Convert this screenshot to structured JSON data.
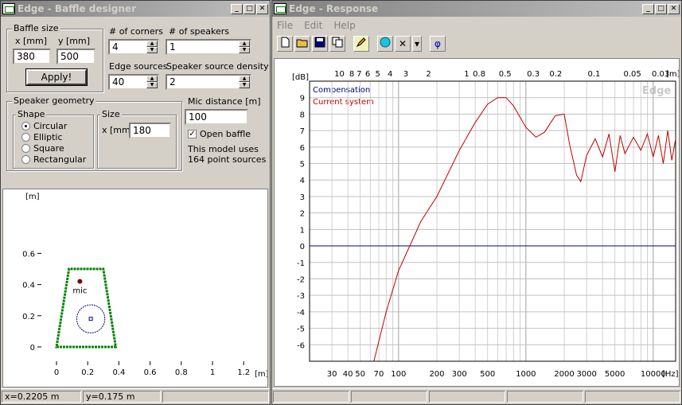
{
  "designer": {
    "title": "Edge - Baffle designer",
    "baffle_size_label": "Baffle size",
    "x_label": "x [mm]",
    "y_label": "y [mm]",
    "x_value": "380",
    "y_value": "500",
    "apply_label": "Apply!",
    "corners_label": "# of corners",
    "corners_value": "4",
    "speakers_label": "# of speakers",
    "speakers_value": "1",
    "edge_sources_label": "Edge sources",
    "edge_sources_value": "40",
    "density_label": "Speaker source density",
    "density_value": "2",
    "geometry_label": "Speaker geometry",
    "shape_label": "Shape",
    "shapes": [
      "Circular",
      "Elliptic",
      "Square",
      "Rectangular"
    ],
    "selected_shape": "Circular",
    "size_label": "Size",
    "size_x_label": "x [mm]",
    "size_x_value": "180",
    "mic_distance_label": "Mic distance [m]",
    "mic_distance_value": "100",
    "open_baffle_label": "Open baffle",
    "open_baffle_checked": true,
    "model_info_1": "This model uses",
    "model_info_2": "164 point sources",
    "plot": {
      "y_unit": "[m]",
      "x_unit": "[m]",
      "y_ticks": [
        "0.6",
        "0.4",
        "0.2",
        "0"
      ],
      "x_ticks": [
        "0",
        "0.2",
        "0.4",
        "0.6",
        "0.8",
        "1",
        "1.2"
      ],
      "mic_label": "mic",
      "baffle_corners_m": [
        [
          0,
          0
        ],
        [
          0.38,
          0
        ],
        [
          0.3,
          0.5
        ],
        [
          0.08,
          0.5
        ]
      ],
      "speaker_center_m": [
        0.22,
        0.18
      ],
      "speaker_diameter_m": 0.18,
      "mic_m": [
        0.15,
        0.42
      ]
    },
    "status_x": "x=0.2205 m",
    "status_y": "y=0.175 m"
  },
  "response": {
    "title": "Edge - Response",
    "menu": [
      "File",
      "Edit",
      "Help"
    ],
    "toolbar_icons": [
      "new-icon",
      "open-icon",
      "save-icon",
      "copy-icon",
      "pencil-icon",
      "sphere-icon",
      "delete-icon",
      "dropdown-icon",
      "phase-icon"
    ],
    "phase_symbol": "φ",
    "delete_symbol": "✕",
    "dropdown_symbol": "▾",
    "watermark": "Edge",
    "colors": {
      "compensation": "#000080",
      "current": "#c00000"
    },
    "chart_data": {
      "type": "line",
      "xlabel": "[Hz]",
      "ylabel": "[dB]",
      "top_axis_unit": "[m]",
      "x_scale": "log",
      "xlim": [
        20,
        15000
      ],
      "ylim": [
        -7,
        10
      ],
      "x_ticks": [
        30,
        40,
        50,
        70,
        100,
        200,
        300,
        500,
        1000,
        2000,
        3000,
        5000,
        10000
      ],
      "y_ticks": [
        9,
        8,
        7,
        6,
        5,
        4,
        3,
        2,
        1,
        0,
        -1,
        -2,
        -3,
        -4,
        -5,
        -6
      ],
      "top_ticks": [
        "10",
        "8",
        "7",
        "6",
        "5",
        "4",
        "3",
        "2",
        "1",
        "0.8",
        "0.5",
        "0.3",
        "0.2",
        "0.1",
        "0.05",
        "0.03"
      ],
      "top_tick_freqs": [
        34.3,
        42.9,
        49,
        57.2,
        68.6,
        85.8,
        114,
        172,
        343,
        429,
        686,
        1143,
        1715,
        3430,
        6860,
        11433
      ],
      "legend": [
        "Compensation",
        "Current system"
      ],
      "series": [
        {
          "name": "Compensation",
          "x": [
            20,
            15000
          ],
          "y": [
            0,
            0
          ]
        },
        {
          "name": "Current system",
          "x": [
            64,
            80,
            100,
            150,
            200,
            300,
            400,
            500,
            600,
            700,
            800,
            1000,
            1200,
            1400,
            1700,
            2000,
            2200,
            2500,
            2700,
            3000,
            3500,
            4000,
            4500,
            5000,
            5500,
            6000,
            7000,
            8000,
            9000,
            10000,
            11000,
            12000,
            13000,
            14000,
            15000
          ],
          "y": [
            -7,
            -4,
            -1.5,
            1.5,
            3,
            5.8,
            7.5,
            8.6,
            9.0,
            9.0,
            8.5,
            7.2,
            6.6,
            6.9,
            7.9,
            8.0,
            6.2,
            4.3,
            3.9,
            5.5,
            6.5,
            5.4,
            6.8,
            4.5,
            6.7,
            5.6,
            6.6,
            5.8,
            6.8,
            5.4,
            6.7,
            5.0,
            7.0,
            5.2,
            6.5
          ]
        }
      ]
    },
    "status_cells": [
      "",
      "",
      "",
      "",
      ""
    ]
  }
}
